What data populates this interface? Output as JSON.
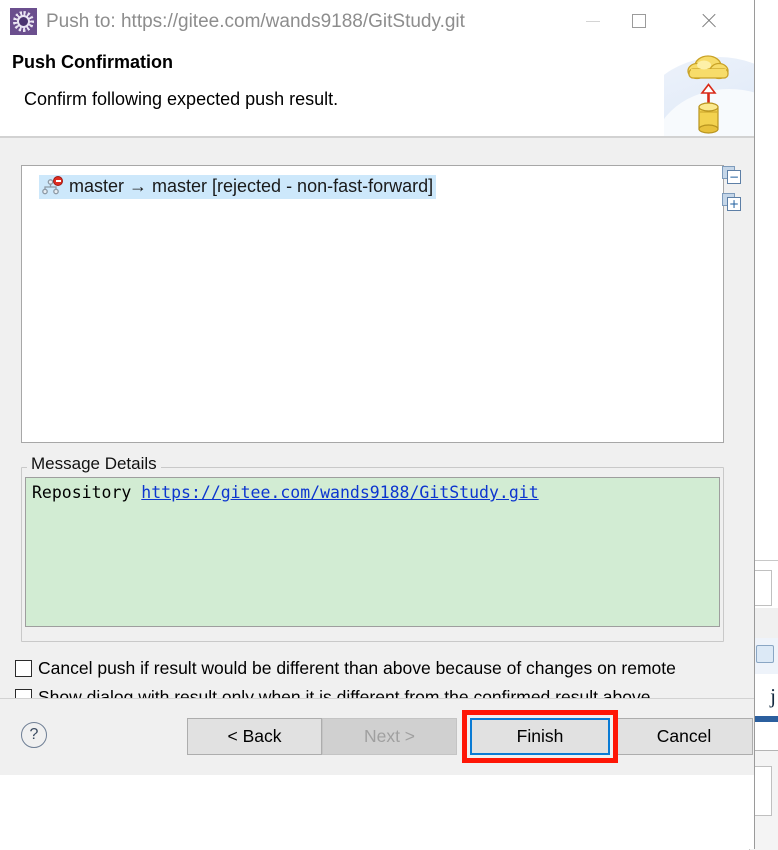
{
  "window": {
    "title": "Push to: https://gitee.com/wands9188/GitStudy.git",
    "app_icon": "eclipse-gear-icon",
    "controls": {
      "minimize": "minimize-icon",
      "maximize": "maximize-icon",
      "close": "close-icon"
    }
  },
  "header": {
    "title": "Push Confirmation",
    "subtitle": "Confirm following expected push result.",
    "banner_icon": "cloud-upload-database-icon"
  },
  "tree": {
    "items": [
      {
        "icon": "branch-error-icon",
        "label": "master → master [rejected - non-fast-forward]",
        "selected": true
      }
    ],
    "tools": [
      {
        "name": "collapse-all",
        "glyph": "−"
      },
      {
        "name": "expand-all",
        "glyph": "+"
      }
    ]
  },
  "message_details": {
    "legend": "Message Details",
    "prefix": "Repository ",
    "link_text": "https://gitee.com/wands9188/GitStudy.git",
    "background_color": "#d2ecd3",
    "link_color": "#0c35cf"
  },
  "options": [
    {
      "label": "Cancel push if result would be different than above because of changes on remote",
      "checked": false
    },
    {
      "label": "Show dialog with result only when it is different from the confirmed result above",
      "checked": false
    }
  ],
  "footer": {
    "help_glyph": "?",
    "buttons": [
      {
        "name": "back",
        "label": "< Back",
        "enabled": true,
        "focused": false
      },
      {
        "name": "next",
        "label": "Next >",
        "enabled": false,
        "focused": false
      },
      {
        "name": "finish",
        "label": "Finish",
        "enabled": true,
        "focused": true
      },
      {
        "name": "cancel",
        "label": "Cancel",
        "enabled": true,
        "focused": false
      }
    ]
  },
  "annotation": {
    "target": "finish-button",
    "color": "#fe1606"
  }
}
